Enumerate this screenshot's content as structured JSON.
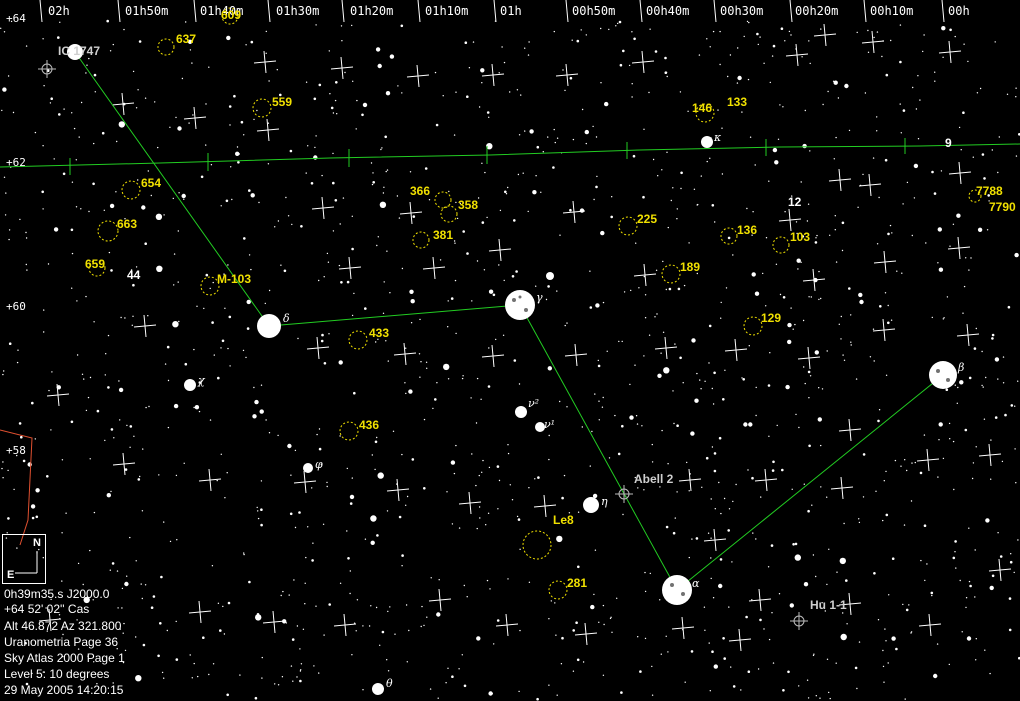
{
  "ra_labels": [
    "02h",
    "01h50m",
    "01h40m",
    "01h30m",
    "01h20m",
    "01h10m",
    "01h",
    "00h50m",
    "00h40m",
    "00h30m",
    "00h20m",
    "00h10m",
    "00h"
  ],
  "dec_labels": [
    "+64",
    "+62",
    "+60",
    "+58"
  ],
  "objects": {
    "ic1747": "IC 1747",
    "m103": "M-103",
    "abell2": "Abell 2",
    "hu11": "Hu 1-1",
    "le8": "Le8",
    "n609": "609",
    "n637": "637",
    "n559": "559",
    "n654": "654",
    "n663": "663",
    "n659": "659",
    "n366": "366",
    "n358": "358",
    "n381": "381",
    "n433": "433",
    "n436": "436",
    "n225": "225",
    "n189": "189",
    "n146": "146",
    "n133": "133",
    "n136": "136",
    "n103": "103",
    "n129": "129",
    "n281": "281",
    "n7788": "7788",
    "n7790": "7790",
    "s44": "44",
    "s12": "12",
    "s9": "9"
  },
  "greek": {
    "delta_l": "δ",
    "gamma": "γ",
    "alpha": "α",
    "beta": "β",
    "eta": "η",
    "nu2": "ν²",
    "nu1": "ν¹",
    "chi": "χ",
    "phi": "φ",
    "theta": "θ",
    "kappa": "κ"
  },
  "info": {
    "ra": "0h39m35.s   J2000.0",
    "dec": "+64 52' 02''       Cas",
    "altaz": "Alt 46.872  Az 321.800",
    "uranometria": "Uranometria Page 36",
    "skyatlas": "Sky Atlas 2000 Page 1",
    "level": "Level 5: 10 degrees",
    "datetime": "29 May 2005 14:20:15"
  },
  "compass": {
    "north": "N",
    "east": "E"
  },
  "colors": {
    "background": "#000000",
    "constellation": "#22cc22",
    "cluster_label": "#f0e000",
    "star": "#ffffff"
  }
}
